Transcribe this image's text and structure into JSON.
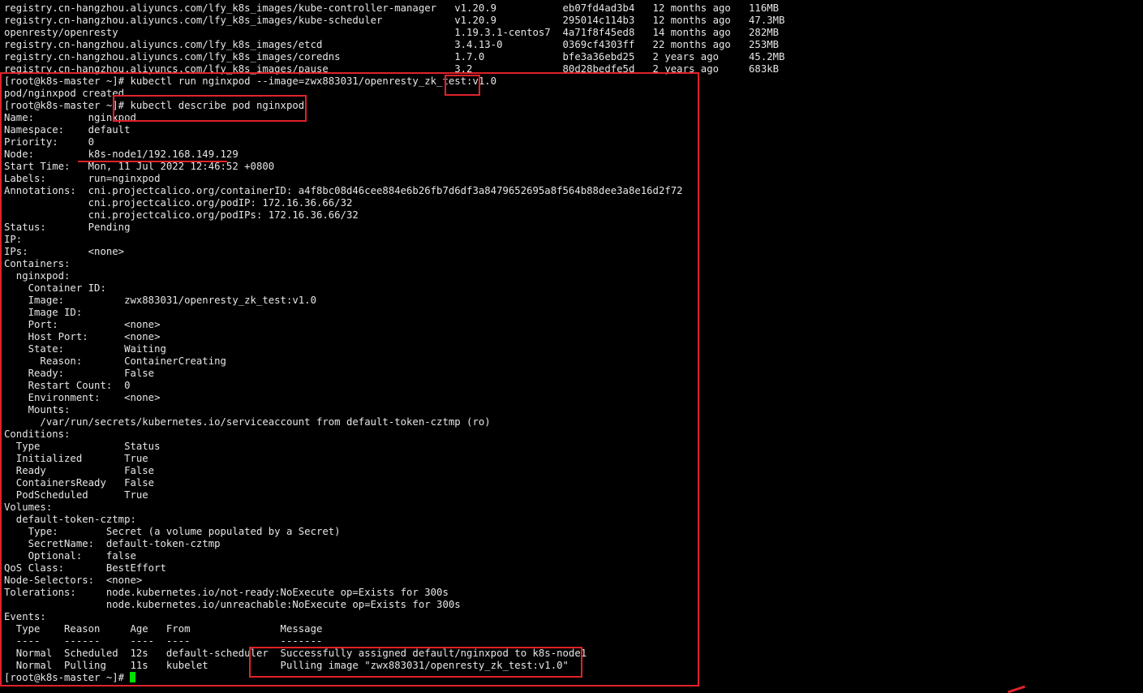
{
  "terminal": {
    "lines": [
      "registry.cn-hangzhou.aliyuncs.com/lfy_k8s_images/kube-controller-manager   v1.20.9           eb07fd4ad3b4   12 months ago   116MB",
      "registry.cn-hangzhou.aliyuncs.com/lfy_k8s_images/kube-scheduler            v1.20.9           295014c114b3   12 months ago   47.3MB",
      "openresty/openresty                                                        1.19.3.1-centos7  4a71f8f45ed8   14 months ago   282MB",
      "registry.cn-hangzhou.aliyuncs.com/lfy_k8s_images/etcd                      3.4.13-0          0369cf4303ff   22 months ago   253MB",
      "registry.cn-hangzhou.aliyuncs.com/lfy_k8s_images/coredns                   1.7.0             bfe3a36ebd25   2 years ago     45.2MB",
      "registry.cn-hangzhou.aliyuncs.com/lfy_k8s_images/pause                     3.2               80d28bedfe5d   2 years ago     683kB",
      "[root@k8s-master ~]# kubectl run nginxpod --image=zwx883031/openresty_zk_test:v1.0",
      "pod/nginxpod created",
      "[root@k8s-master ~]# kubectl describe pod nginxpod",
      "Name:         nginxpod",
      "Namespace:    default",
      "Priority:     0",
      "Node:         k8s-node1/192.168.149.129",
      "Start Time:   Mon, 11 Jul 2022 12:46:52 +0800",
      "Labels:       run=nginxpod",
      "Annotations:  cni.projectcalico.org/containerID: a4f8bc08d46cee884e6b26fb7d6df3a8479652695a8f564b88dee3a8e16d2f72",
      "              cni.projectcalico.org/podIP: 172.16.36.66/32",
      "              cni.projectcalico.org/podIPs: 172.16.36.66/32",
      "Status:       Pending",
      "IP:",
      "IPs:          <none>",
      "Containers:",
      "  nginxpod:",
      "    Container ID:",
      "    Image:          zwx883031/openresty_zk_test:v1.0",
      "    Image ID:",
      "    Port:           <none>",
      "    Host Port:      <none>",
      "    State:          Waiting",
      "      Reason:       ContainerCreating",
      "    Ready:          False",
      "    Restart Count:  0",
      "    Environment:    <none>",
      "    Mounts:",
      "      /var/run/secrets/kubernetes.io/serviceaccount from default-token-cztmp (ro)",
      "Conditions:",
      "  Type              Status",
      "  Initialized       True",
      "  Ready             False",
      "  ContainersReady   False",
      "  PodScheduled      True",
      "Volumes:",
      "  default-token-cztmp:",
      "    Type:        Secret (a volume populated by a Secret)",
      "    SecretName:  default-token-cztmp",
      "    Optional:    false",
      "QoS Class:       BestEffort",
      "Node-Selectors:  <none>",
      "Tolerations:     node.kubernetes.io/not-ready:NoExecute op=Exists for 300s",
      "                 node.kubernetes.io/unreachable:NoExecute op=Exists for 300s",
      "Events:",
      "  Type    Reason     Age   From               Message",
      "  ----    ------     ----  ----               -------",
      "  Normal  Scheduled  12s   default-scheduler  Successfully assigned default/nginxpod to k8s-node1",
      "  Normal  Pulling    11s   kubelet            Pulling image \"zwx883031/openresty_zk_test:v1.0\"",
      "[root@k8s-master ~]# "
    ]
  },
  "colors": {
    "background": "#000000",
    "text": "#e6e6e6",
    "cursor": "#00e000",
    "annotation": "#e0222a"
  }
}
